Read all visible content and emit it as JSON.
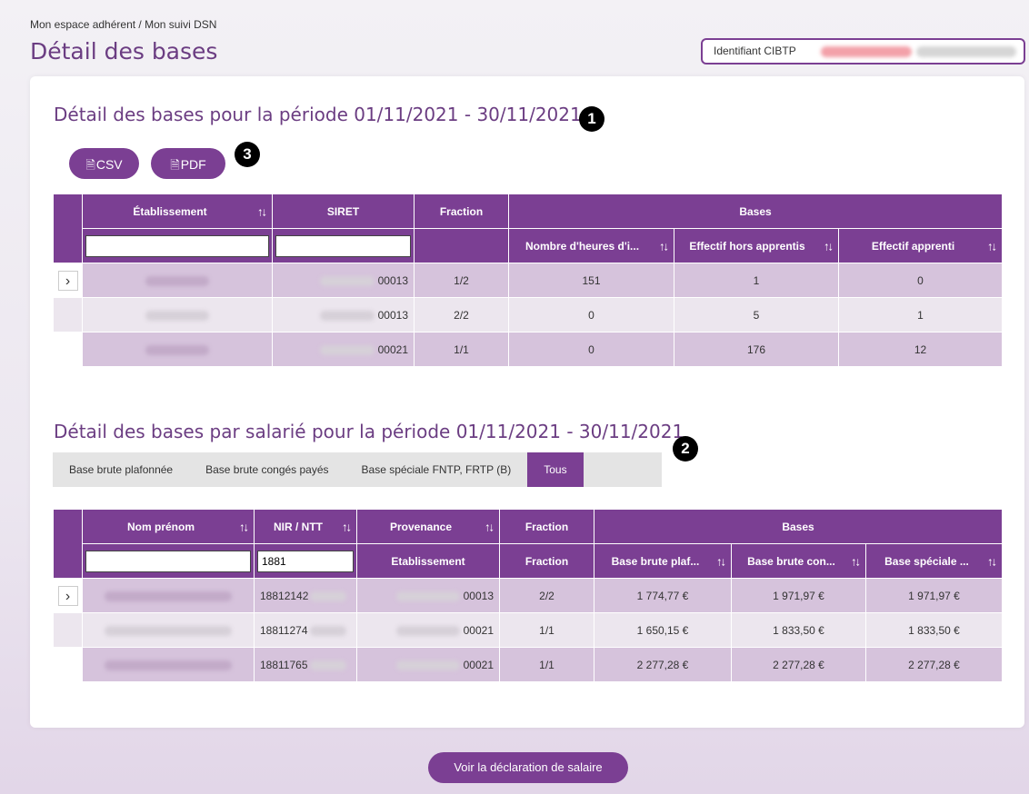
{
  "breadcrumb": "Mon espace adhérent / Mon suivi DSN",
  "page_title": "Détail des bases",
  "id_label": "Identifiant CIBTP",
  "section1": {
    "title": "Détail des bases pour la période 01/11/2021 - 30/11/2021",
    "badge": "1",
    "csv_label": "CSV",
    "pdf_label": "PDF",
    "export_badge": "3",
    "headers": {
      "etablissement": "Établissement",
      "siret": "SIRET",
      "fraction": "Fraction",
      "bases": "Bases",
      "heures": "Nombre d'heures d'i...",
      "effectif_hors": "Effectif hors apprentis",
      "effectif_app": "Effectif apprenti"
    },
    "rows": [
      {
        "siret": "00013",
        "fraction": "1/2",
        "heures": "151",
        "effectif_hors": "1",
        "effectif_app": "0"
      },
      {
        "siret": "00013",
        "fraction": "2/2",
        "heures": "0",
        "effectif_hors": "5",
        "effectif_app": "1"
      },
      {
        "siret": "00021",
        "fraction": "1/1",
        "heures": "0",
        "effectif_hors": "176",
        "effectif_app": "12"
      }
    ]
  },
  "section2": {
    "title": "Détail des bases par salarié pour la période 01/11/2021 - 30/11/2021",
    "badge": "2",
    "filters": [
      "Base brute plafonnée",
      "Base brute congés payés",
      "Base spéciale FNTP, FRTP (B)",
      "Tous"
    ],
    "headers": {
      "nom": "Nom prénom",
      "nir": "NIR / NTT",
      "provenance": "Provenance",
      "fraction": "Fraction",
      "bases": "Bases",
      "etablissement": "Etablissement",
      "fraction2": "Fraction",
      "base_plaf": "Base brute plaf...",
      "base_cong": "Base brute con...",
      "base_spec": "Base spéciale ..."
    },
    "nir_filter": "1881",
    "rows": [
      {
        "nir": "18812142",
        "etab": "00013",
        "fraction": "2/2",
        "base_plaf": "1 774,77 €",
        "base_cong": "1 971,97 €",
        "base_spec": "1 971,97 €"
      },
      {
        "nir": "18811274",
        "etab": "00021",
        "fraction": "1/1",
        "base_plaf": "1 650,15 €",
        "base_cong": "1 833,50 €",
        "base_spec": "1 833,50 €"
      },
      {
        "nir": "18811765",
        "etab": "00021",
        "fraction": "1/1",
        "base_plaf": "2 277,28 €",
        "base_cong": "2 277,28 €",
        "base_spec": "2 277,28 €"
      }
    ]
  },
  "see_button": "Voir la déclaration de salaire",
  "colors": {
    "accent": "#7b3f93",
    "row_odd": "#d6c3dc",
    "row_even": "#ece6ee"
  }
}
